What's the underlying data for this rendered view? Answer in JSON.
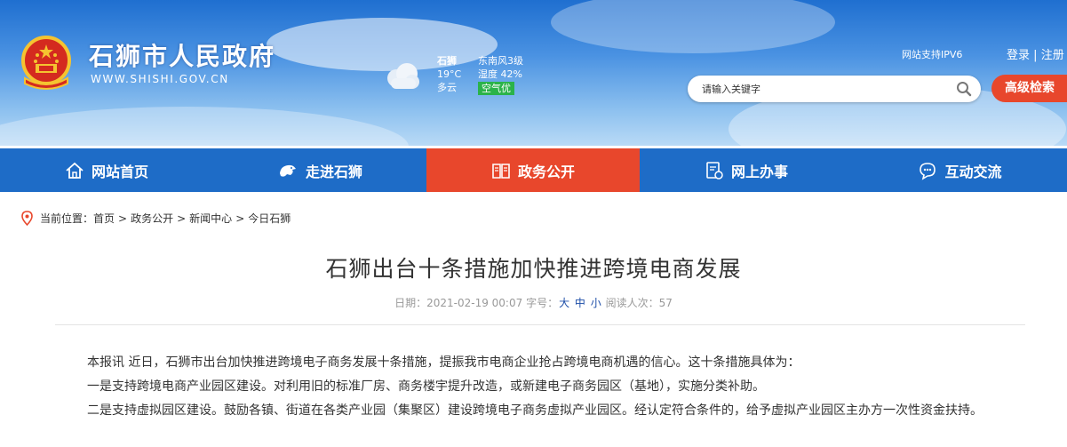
{
  "header": {
    "site_name": "石狮市人民政府",
    "site_url": "WWW.SHISHI.GOV.CN",
    "ipv6": "网站支持IPV6",
    "login": "登录",
    "login_sep": "|",
    "register": "注册"
  },
  "weather": {
    "city": "石狮",
    "temperature": "19°C",
    "condition": "多云",
    "wind": "东南风3级",
    "humidity": "湿度 42%",
    "air_quality": "空气优",
    "icon": "cloudy-icon"
  },
  "search": {
    "placeholder": "请输入关键字",
    "advanced_label": "高级检索"
  },
  "nav": {
    "items": [
      {
        "label": "网站首页",
        "icon": "home-icon"
      },
      {
        "label": "走进石狮",
        "icon": "lion-icon"
      },
      {
        "label": "政务公开",
        "icon": "book-icon"
      },
      {
        "label": "网上办事",
        "icon": "service-icon"
      },
      {
        "label": "互动交流",
        "icon": "chat-icon"
      }
    ],
    "active_index": 2
  },
  "breadcrumb": {
    "prefix": "当前位置：",
    "items": [
      "首页",
      "政务公开",
      "新闻中心",
      "今日石狮"
    ],
    "sep": ">"
  },
  "article": {
    "title": "石狮出台十条措施加快推进跨境电商发展",
    "date_label": "日期：",
    "date": "2021-02-19 00:07",
    "font_label": "字号：",
    "font_large": "大",
    "font_medium": "中",
    "font_small": "小",
    "views_label": "阅读人次：",
    "views": "57",
    "paragraphs": [
      "本报讯 近日，石狮市出台加快推进跨境电子商务发展十条措施，提振我市电商企业抢占跨境电商机遇的信心。这十条措施具体为：",
      "一是支持跨境电商产业园区建设。对利用旧的标准厂房、商务楼宇提升改造，或新建电子商务园区（基地），实施分类补助。",
      "二是支持虚拟园区建设。鼓励各镇、街道在各类产业园（集聚区）建设跨境电子商务虚拟产业园区。经认定符合条件的，给予虚拟产业园区主办方一次性资金扶持。"
    ]
  },
  "colors": {
    "nav_bg": "#1e6cc7",
    "nav_active": "#e8472c",
    "accent_red": "#e8472c",
    "aqi_green": "#2bb34a"
  }
}
